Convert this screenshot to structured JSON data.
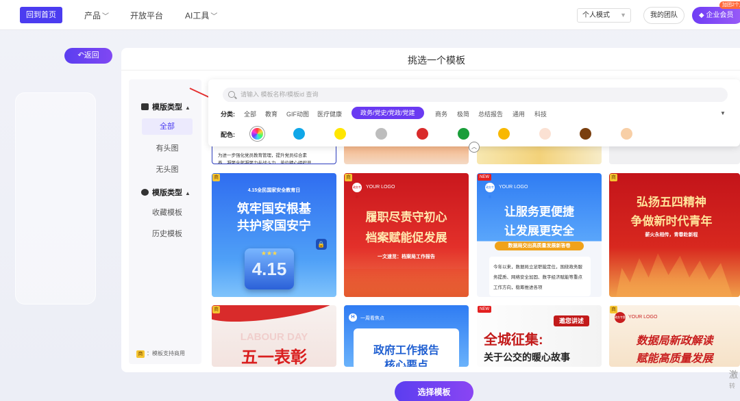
{
  "nav": {
    "home": "回到首页",
    "items": [
      {
        "label": "产品",
        "has_dropdown": true
      },
      {
        "label": "开放平台",
        "has_dropdown": false
      },
      {
        "label": "AI工具",
        "has_dropdown": true
      }
    ],
    "mode_select": "个人模式",
    "team": "我的团队",
    "vip": "企业会员",
    "vip_badge": "加团2个月"
  },
  "back": "返回",
  "panel_title": "挑选一个模板",
  "sidebar": {
    "group1": "模版类型",
    "items1": [
      "全部",
      "有头图",
      "无头图"
    ],
    "active_index": 0,
    "group2": "模版类型",
    "items2": [
      "收藏模板",
      "历史模板"
    ],
    "footer_tag": "商",
    "footer_text": "：模板支持商用"
  },
  "filter": {
    "search_placeholder": "请输入 模板名称/模板id 查询",
    "category_label": "分类:",
    "categories": [
      "全部",
      "教育",
      "GIF动图",
      "医疗健康",
      "政务/党史/党政/党建",
      "商务",
      "极简",
      "总结报告",
      "通用",
      "科技"
    ],
    "active_category": "政务/党史/党政/党建",
    "color_label": "配色:",
    "colors": [
      "rainbow",
      "#10a7e8",
      "#ffe600",
      "#bdbdbd",
      "#d92b2b",
      "#1a9e3a",
      "#f8b800",
      "#fbe1d3",
      "#7a3f0f",
      "#f8cfa6"
    ]
  },
  "cards_top_partial": {
    "text1": "为进一步强化党员教育管理，提升党员综合素",
    "text2": "养，凝聚全部凝聚力与战斗力，单位精心组织开"
  },
  "cards": [
    {
      "badge": "商",
      "top": "4.15全民国家安全教育日",
      "title1": "筑牢国安根基",
      "title2": "共护家国安宁",
      "number": "4.15"
    },
    {
      "badge": "商",
      "logo": "YOUR LOGO",
      "logo_mark": "政务专题",
      "title1": "履职尽责守初心",
      "title2": "档案赋能促发展",
      "sub": "一文速览：档案局工作报告"
    },
    {
      "badge": "NEW",
      "logo": "YOUR LOGO",
      "logo_mark": "政务专题",
      "title1": "让服务更便捷",
      "title2": "让发展更安全",
      "ribbon": "数据局交出高质量发展新答卷",
      "body": "今年以来，数据局立足职能定位，围绕政务服务提质、网络安全加固、数字经济赋能等重点工作方向，稳筹推进各项"
    },
    {
      "badge": "商",
      "title1": "弘扬五四精神",
      "title2": "争做新时代青年",
      "sub": "薪火永相传，青春赴新程"
    },
    {
      "badge": "商",
      "bg_text": "LABOUR DAY",
      "title1": "五一表彰"
    },
    {
      "badge": "H",
      "header": "一周看焦点",
      "title1": "政府工作报告",
      "title2": "核心要点"
    },
    {
      "badge": "NEW",
      "title1": "全城征集:",
      "tag": "邀您讲述",
      "title2": "关于公交的暖心故事"
    },
    {
      "badge": "商",
      "logo": "YOUR LOGO",
      "logo_mark": "政务专题",
      "title1": "数据局新政解读",
      "title2": "赋能高质量发展"
    }
  ],
  "select_button": "选择模板",
  "watermark": {
    "line1": "激",
    "line2": "转"
  }
}
